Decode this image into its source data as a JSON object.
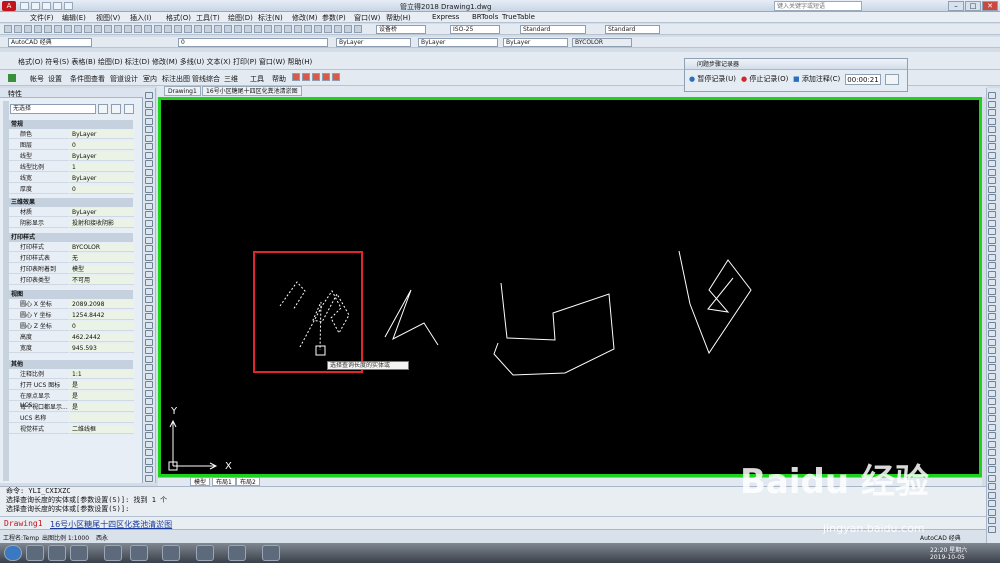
{
  "app": {
    "title": "管立得2018     Drawing1.dwg",
    "search_placeholder": "键入关键字或短语"
  },
  "menus": [
    "文件(F)",
    "编辑(E)",
    "视图(V)",
    "插入(I)",
    "格式(O)",
    "工具(T)",
    "绘图(D)",
    "标注(N)",
    "修改(M)",
    "参数(P)",
    "窗口(W)",
    "帮助(H)",
    "Express",
    "BRTools",
    "TrueTable"
  ],
  "toolbar1": {
    "text_style": "设备桥",
    "dim_style": "ISO-25",
    "table_style": "Standard",
    "ml_style": "Standard"
  },
  "toolbar2": {
    "workspace": "AutoCAD 经典",
    "layer": "0",
    "color": "ByLayer",
    "linetype": "ByLayer",
    "lineweight": "ByLayer",
    "plotstyle": "BYCOLOR"
  },
  "app_menu": [
    "设置",
    "条件图查看",
    "管道设计",
    "室内",
    "标注出图",
    "管线综合",
    "三维",
    "工具",
    "帮助"
  ],
  "app_menu_first": "格式(O)   符号(S)   表格(B)   绘图(D)   标注(D)   修改(M)   多线(U)   文本(X)   打印(P)   窗口(W)   帮助(H)",
  "app_menu_first_short": "帐号",
  "panel": {
    "title": "特性",
    "selection": "无选择"
  },
  "properties": {
    "general": {
      "title": "常规",
      "rows": [
        [
          "颜色",
          "ByLayer"
        ],
        [
          "图层",
          "0"
        ],
        [
          "线型",
          "ByLayer"
        ],
        [
          "线型比例",
          "1"
        ],
        [
          "线宽",
          "ByLayer"
        ],
        [
          "厚度",
          "0"
        ]
      ]
    },
    "three_d": {
      "title": "三维效果",
      "rows": [
        [
          "材质",
          "ByLayer"
        ],
        [
          "阴影显示",
          "投射和接收阴影"
        ]
      ]
    },
    "plot": {
      "title": "打印样式",
      "rows": [
        [
          "打印样式",
          "BYCOLOR"
        ],
        [
          "打印样式表",
          "无"
        ],
        [
          "打印表附着到",
          "模型"
        ],
        [
          "打印表类型",
          "不可用"
        ]
      ]
    },
    "view": {
      "title": "视图",
      "rows": [
        [
          "圆心 X 坐标",
          "2089.2098"
        ],
        [
          "圆心 Y 坐标",
          "1254.8442"
        ],
        [
          "圆心 Z 坐标",
          "0"
        ],
        [
          "高度",
          "462.2442"
        ],
        [
          "宽度",
          "945.593"
        ]
      ]
    },
    "misc": {
      "title": "其他",
      "rows": [
        [
          "注释比例",
          "1:1"
        ],
        [
          "打开 UCS 图标",
          "是"
        ],
        [
          "在原点显示 UCS...",
          "是"
        ],
        [
          "每个视口都显示...",
          "是"
        ],
        [
          "UCS 名称",
          ""
        ],
        [
          "视觉样式",
          "二维线框"
        ]
      ]
    }
  },
  "file_tabs": [
    "Drawing1",
    "16号小区糖尾十四区化粪池清淤图"
  ],
  "recorder": {
    "title": "问题步骤记录器",
    "pause": "暂停记录(U)",
    "stop": "停止记录(O)",
    "comment": "添加注释(C)",
    "time": "00:00:21"
  },
  "tooltip": "选择查询长度的实体或",
  "ucs": {
    "x": "X",
    "y": "Y"
  },
  "layout_tabs": [
    "模型",
    "布局1",
    "布局2"
  ],
  "command_lines": [
    "命令: YLI_CXIXZC",
    "选择查询长度的实体或[参数设置(S)]: 找到 1 个",
    "选择查询长度的实体或[参数设置(S)]:"
  ],
  "bottom_tabs": {
    "active": "Drawing1",
    "other": "16号小区糖尾十四区化粪池清淤图"
  },
  "status": {
    "project": "工程名:Temp",
    "scale": "出图比例 1:1000",
    "slope": "西永"
  },
  "tray": {
    "app": "AutoCAD 经典",
    "time": "22:20 星期六",
    "date": "2019-10-05"
  },
  "watermark": {
    "brand": "Baidu 经验",
    "url": "jingyan.baidu.com"
  },
  "colors": {
    "highlight": "#e0262c",
    "canvas_border": "#1dd21d",
    "canvas": "#000000"
  }
}
